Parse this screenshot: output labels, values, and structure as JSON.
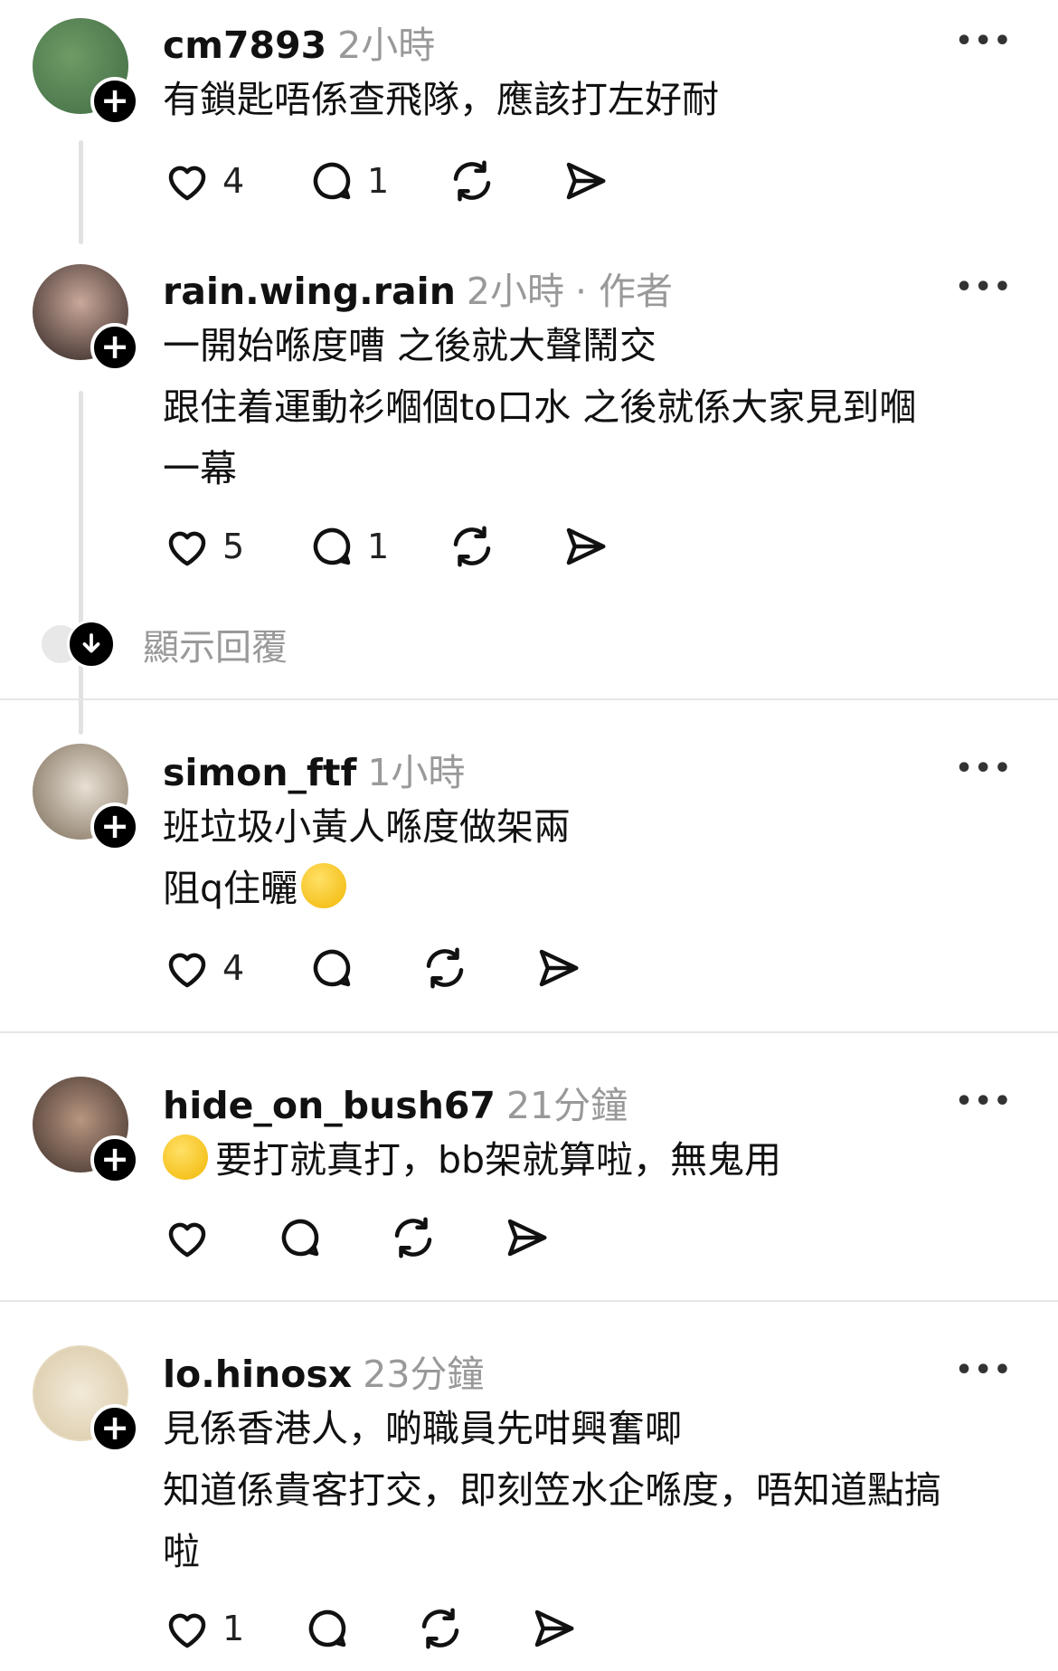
{
  "posts": [
    {
      "username": "cm7893",
      "time": "2小時",
      "lines": [
        "有鎖匙唔係查飛隊，應該打左好耐"
      ],
      "likes": "4",
      "replies": "1",
      "avatar_color": "#4d7a4f"
    },
    {
      "username": "rain.wing.rain",
      "time": "2小時",
      "badge": "· 作者",
      "lines": [
        "一開始喺度嘈 之後就大聲鬧交",
        "跟住着運動衫嗰個to口水 之後就係大家見到嗰",
        "一幕"
      ],
      "likes": "5",
      "replies": "1",
      "avatar_color": "#3a2e2c"
    },
    {
      "username": "simon_ftf",
      "time": "1小時",
      "lines": [
        "班垃圾小黃人喺度做架兩",
        "阻q住曬"
      ],
      "likes": "4",
      "replies": "",
      "avatar_color": "#8a7a68"
    },
    {
      "username": "hide_on_bush67",
      "time": "21分鐘",
      "lines": [
        "要打就真打，bb架就算啦，無鬼用"
      ],
      "likes": "",
      "replies": "",
      "avatar_color": "#5b4a44"
    },
    {
      "username": "lo.hinosx",
      "time": "23分鐘",
      "lines": [
        "見係香港人，啲職員先咁興奮唧",
        "知道係貴客打交，即刻笠水企喺度，唔知道點搞",
        "啦"
      ],
      "likes": "1",
      "replies": "",
      "avatar_color": "#e9dcc4"
    }
  ],
  "show_replies": "顯示回覆",
  "more_glyph": "•••"
}
